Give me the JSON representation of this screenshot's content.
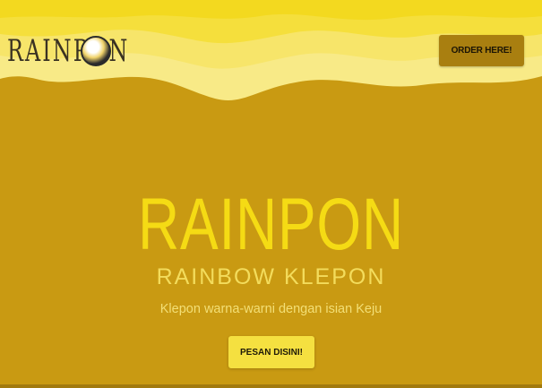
{
  "brand": {
    "logo_text": "RAINPON"
  },
  "header": {
    "order_button_label": "ORDER HERE!"
  },
  "hero": {
    "title": "RAINPON",
    "subtitle": "RAINBOW KLEPON",
    "tagline": "Klepon warna-warni dengan isian Keju",
    "cta_label": "PESAN DISINI!"
  },
  "colors": {
    "background": "#c99a12",
    "wave_light": "#f8ea87",
    "wave_mid": "#f5df3c",
    "title": "#f5db14",
    "order_button": "#a97f10",
    "cta_button": "#f5e040"
  }
}
